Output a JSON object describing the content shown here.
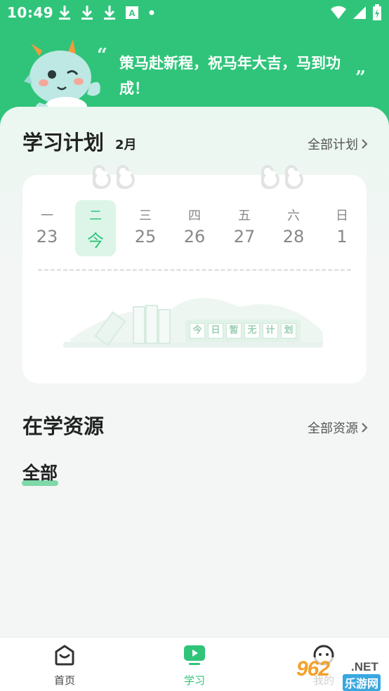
{
  "status_bar": {
    "time": "10:49",
    "left_icons": [
      "download-icon",
      "download-icon",
      "download-icon",
      "a-icon",
      "dot-icon"
    ],
    "right_icons": [
      "wifi-icon",
      "signal-icon",
      "battery-icon"
    ]
  },
  "header": {
    "slogan": "策马赴新程，祝马年大吉，马到功成！",
    "quote_open": "“",
    "quote_close": "”",
    "mascot": "dragon-mascot"
  },
  "plan": {
    "title": "学习计划",
    "month": "2月",
    "more_label": "全部计划",
    "days": [
      {
        "weekday": "一",
        "date": "23",
        "today": false
      },
      {
        "weekday": "二",
        "date": "今",
        "today": true
      },
      {
        "weekday": "三",
        "date": "25",
        "today": false
      },
      {
        "weekday": "四",
        "date": "26",
        "today": false
      },
      {
        "weekday": "五",
        "date": "27",
        "today": false
      },
      {
        "weekday": "六",
        "date": "28",
        "today": false
      },
      {
        "weekday": "日",
        "date": "1",
        "today": false
      }
    ],
    "empty_chars": [
      "今",
      "日",
      "暂",
      "无",
      "计",
      "划"
    ]
  },
  "resources": {
    "title": "在学资源",
    "more_label": "全部资源",
    "active_tab": "全部"
  },
  "bottom_nav": {
    "items": [
      {
        "label": "首页",
        "icon": "home-icon",
        "active": false
      },
      {
        "label": "学习",
        "icon": "play-icon",
        "active": true
      },
      {
        "label": "我的",
        "icon": "face-icon",
        "active": false
      }
    ]
  },
  "watermark": {
    "num": "962",
    "net": ".NET",
    "cn": "乐游网"
  },
  "colors": {
    "accent": "#2fc47a",
    "today_bg": "#ddf5e8",
    "underline": "#7fd8a8"
  }
}
